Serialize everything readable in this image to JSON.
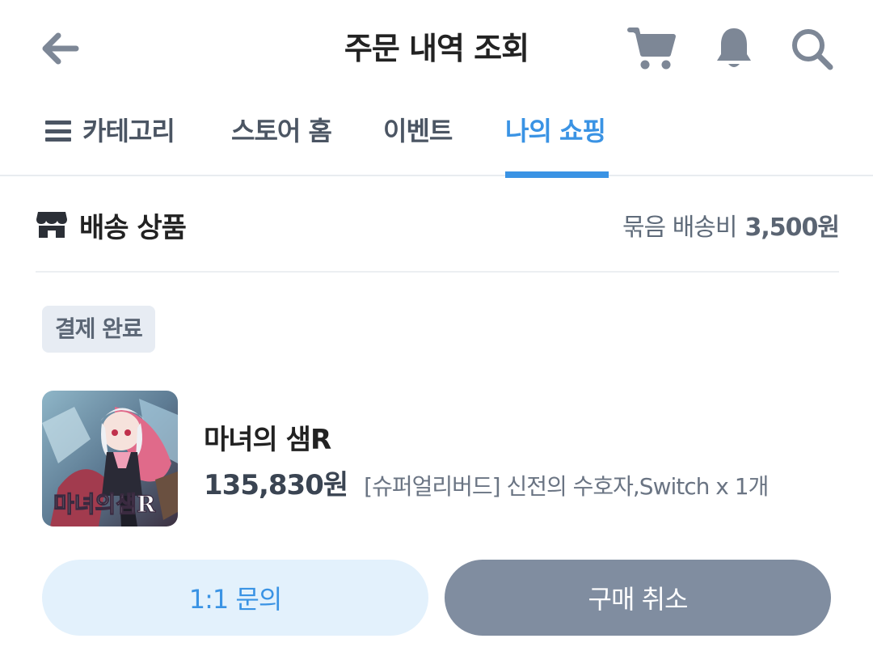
{
  "header": {
    "title": "주문 내역 조회",
    "icons": {
      "back": "arrow-left-icon",
      "cart": "cart-icon",
      "bell": "bell-icon",
      "search": "search-icon"
    }
  },
  "tabs": [
    {
      "label": "카테고리",
      "icon": "hamburger-menu-icon",
      "active": false
    },
    {
      "label": "스토어 홈",
      "active": false
    },
    {
      "label": "이벤트",
      "active": false
    },
    {
      "label": "나의 쇼핑",
      "active": true
    }
  ],
  "shipping": {
    "title": "배송 상품",
    "icon": "store-icon",
    "fee_label": "묶음 배송비",
    "fee_value": "3,500원"
  },
  "order": {
    "status": "결제 완료",
    "product": {
      "name": "마녀의 샘R",
      "price": "135,830원",
      "option": "[슈퍼얼리버드] 신전의 수호자,Switch x 1개",
      "thumbnail_text": "마녀의샘R"
    }
  },
  "buttons": {
    "inquiry": "1:1 문의",
    "cancel": "구매 취소"
  },
  "colors": {
    "accent": "#3a93e4",
    "icon_gray": "#7d8796",
    "badge_bg": "#e7ecf3",
    "inquiry_bg": "#e3f1fc",
    "cancel_bg": "#808da0"
  }
}
